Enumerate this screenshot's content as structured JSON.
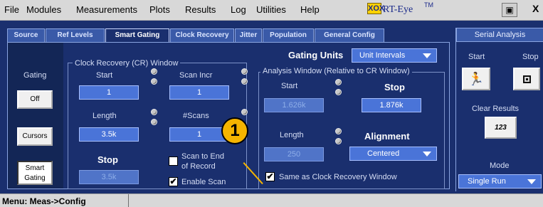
{
  "menu": {
    "items": [
      "File",
      "Modules",
      "Measurements",
      "Plots",
      "Results",
      "Log",
      "Utilities",
      "Help"
    ],
    "logo_mark": "XOX",
    "app_name": "RT-Eye",
    "app_tm": "TM",
    "close_label": "X"
  },
  "tabs": [
    {
      "label": "Source"
    },
    {
      "label": "Ref Levels"
    },
    {
      "label": "Smart Gating",
      "active": true
    },
    {
      "label": "Clock Recovery"
    },
    {
      "label": "Jitter"
    },
    {
      "label": "Population"
    },
    {
      "label": "General Config"
    }
  ],
  "gating": {
    "label": "Gating",
    "off_button": "Off",
    "cursors_button": "Cursors",
    "smart_button_line1": "Smart",
    "smart_button_line2": "Gating"
  },
  "cr_window": {
    "title": "Clock Recovery (CR) Window",
    "start_label": "Start",
    "start_value": "1",
    "scan_incr_label": "Scan Incr",
    "scan_incr_value": "1",
    "length_label": "Length",
    "length_value": "3.5k",
    "scans_label": "#Scans",
    "scans_value": "1",
    "stop_label": "Stop",
    "stop_value": "3.5k",
    "scan_to_end_line1": "Scan to End",
    "scan_to_end_line2": "of Record",
    "scan_to_end_checked": false,
    "enable_scan_label": "Enable Scan",
    "enable_scan_checked": true
  },
  "gating_units": {
    "label": "Gating Units",
    "value": "Unit Intervals"
  },
  "analysis_window": {
    "title": "Analysis Window (Relative to CR Window)",
    "start_label": "Start",
    "start_value": "1.626k",
    "stop_label": "Stop",
    "stop_value": "1.876k",
    "length_label": "Length",
    "length_value": "250",
    "alignment_label": "Alignment",
    "alignment_value": "Centered",
    "same_as_cr_label": "Same as Clock Recovery Window",
    "same_as_cr_checked": true
  },
  "callout": {
    "number": "1"
  },
  "serial_analysis": {
    "title": "Serial Analysis",
    "start_label": "Start",
    "stop_label": "Stop",
    "clear_results_label": "Clear Results",
    "clear_icon_text": "123",
    "mode_label": "Mode",
    "mode_value": "Single Run"
  },
  "status": {
    "text": "Menu: Meas->Config"
  }
}
